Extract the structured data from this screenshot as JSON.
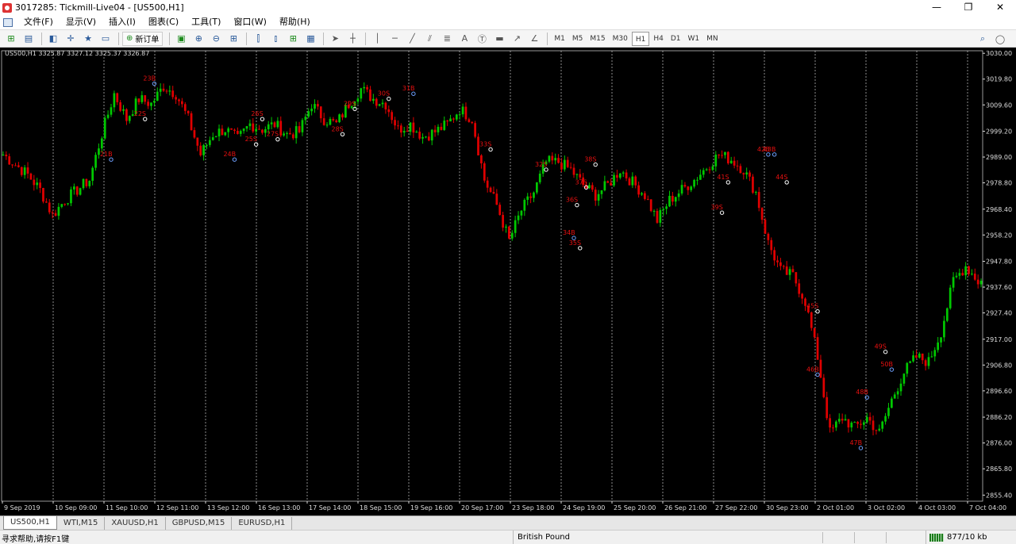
{
  "window": {
    "title": "3017285: Tickmill-Live04 - [US500,H1]",
    "controls": [
      "—",
      "❐",
      "✕"
    ]
  },
  "menu": {
    "items": [
      "文件(F)",
      "显示(V)",
      "插入(I)",
      "图表(C)",
      "工具(T)",
      "窗口(W)",
      "帮助(H)"
    ]
  },
  "toolbar": {
    "new_order_label": "新订单",
    "timeframes": [
      "M1",
      "M5",
      "M15",
      "M30",
      "H1",
      "H4",
      "D1",
      "W1",
      "MN"
    ],
    "active_timeframe": "H1"
  },
  "chart": {
    "info": "US500,H1  3325.87 3327.12 3325.37 3326.87",
    "colors": {
      "background": "#000000",
      "up": "#00c800",
      "down": "#e00000",
      "grid": "#c8c8c8",
      "marker_text": "#e81010"
    }
  },
  "chart_data": {
    "type": "candlestick",
    "symbol": "US500",
    "timeframe": "H1",
    "y_ticks": [
      3030.0,
      3019.8,
      3009.6,
      2999.2,
      2989.0,
      2978.8,
      2968.4,
      2958.2,
      2947.8,
      2937.6,
      2927.4,
      2917.0,
      2906.8,
      2896.6,
      2886.2,
      2876.0,
      2865.8,
      2855.4
    ],
    "ylim": [
      2853.0,
      3031.0
    ],
    "x_ticks": [
      "9 Sep 2019",
      "10 Sep 09:00",
      "11 Sep 10:00",
      "12 Sep 11:00",
      "13 Sep 12:00",
      "16 Sep 13:00",
      "17 Sep 14:00",
      "18 Sep 15:00",
      "19 Sep 16:00",
      "20 Sep 17:00",
      "23 Sep 18:00",
      "24 Sep 19:00",
      "25 Sep 20:00",
      "26 Sep 21:00",
      "27 Sep 22:00",
      "30 Sep 23:00",
      "2 Oct 01:00",
      "3 Oct 02:00",
      "4 Oct 03:00",
      "7 Oct 04:00"
    ],
    "price_path": [
      [
        0,
        2990
      ],
      [
        4,
        2986
      ],
      [
        8,
        2982
      ],
      [
        12,
        2976
      ],
      [
        16,
        2966
      ],
      [
        20,
        2972
      ],
      [
        24,
        2976
      ],
      [
        28,
        2980
      ],
      [
        32,
        2998
      ],
      [
        36,
        3014
      ],
      [
        40,
        3004
      ],
      [
        44,
        3012
      ],
      [
        48,
        3010
      ],
      [
        52,
        3017
      ],
      [
        56,
        3014
      ],
      [
        60,
        3004
      ],
      [
        64,
        2990
      ],
      [
        68,
        2998
      ],
      [
        72,
        3000
      ],
      [
        76,
        2996
      ],
      [
        80,
        3002
      ],
      [
        84,
        3000
      ],
      [
        88,
        3002
      ],
      [
        92,
        2998
      ],
      [
        96,
        2999
      ],
      [
        100,
        3010
      ],
      [
        104,
        3004
      ],
      [
        108,
        3002
      ],
      [
        112,
        3010
      ],
      [
        116,
        3016
      ],
      [
        120,
        3012
      ],
      [
        124,
        3010
      ],
      [
        128,
        3000
      ],
      [
        132,
        3002
      ],
      [
        136,
        2997
      ],
      [
        140,
        2999
      ],
      [
        144,
        3002
      ],
      [
        148,
        3008
      ],
      [
        152,
        3004
      ],
      [
        156,
        2980
      ],
      [
        160,
        2970
      ],
      [
        164,
        2956
      ],
      [
        168,
        2968
      ],
      [
        172,
        2975
      ],
      [
        176,
        2987
      ],
      [
        180,
        2987
      ],
      [
        184,
        2984
      ],
      [
        188,
        2978
      ],
      [
        192,
        2974
      ],
      [
        196,
        2978
      ],
      [
        200,
        2984
      ],
      [
        204,
        2979
      ],
      [
        208,
        2974
      ],
      [
        212,
        2964
      ],
      [
        216,
        2972
      ],
      [
        220,
        2976
      ],
      [
        224,
        2980
      ],
      [
        228,
        2985
      ],
      [
        232,
        2990
      ],
      [
        236,
        2988
      ],
      [
        240,
        2984
      ],
      [
        244,
        2975
      ],
      [
        248,
        2955
      ],
      [
        252,
        2944
      ],
      [
        256,
        2942
      ],
      [
        260,
        2932
      ],
      [
        264,
        2910
      ],
      [
        268,
        2880
      ],
      [
        272,
        2886
      ],
      [
        276,
        2882
      ],
      [
        280,
        2886
      ],
      [
        284,
        2880
      ],
      [
        288,
        2893
      ],
      [
        292,
        2904
      ],
      [
        296,
        2910
      ],
      [
        300,
        2908
      ],
      [
        304,
        2920
      ],
      [
        308,
        2940
      ],
      [
        312,
        2946
      ],
      [
        316,
        2940
      ]
    ],
    "markers": [
      {
        "label": "21B",
        "x": 35,
        "y": 2988
      },
      {
        "label": "22S",
        "x": 46,
        "y": 3004
      },
      {
        "label": "23B",
        "x": 49,
        "y": 3018
      },
      {
        "label": "24B",
        "x": 75,
        "y": 2988
      },
      {
        "label": "25S",
        "x": 82,
        "y": 2994
      },
      {
        "label": "26S",
        "x": 84,
        "y": 3004
      },
      {
        "label": "27S",
        "x": 89,
        "y": 2996
      },
      {
        "label": "28S",
        "x": 110,
        "y": 2998
      },
      {
        "label": "29S",
        "x": 114,
        "y": 3008
      },
      {
        "label": "30S",
        "x": 125,
        "y": 3012
      },
      {
        "label": "31B",
        "x": 133,
        "y": 3014
      },
      {
        "label": "32S",
        "x": 176,
        "y": 2984
      },
      {
        "label": "33S",
        "x": 158,
        "y": 2992
      },
      {
        "label": "34B",
        "x": 185,
        "y": 2957
      },
      {
        "label": "35S",
        "x": 187,
        "y": 2953
      },
      {
        "label": "36S",
        "x": 186,
        "y": 2970
      },
      {
        "label": "37S",
        "x": 189,
        "y": 2977
      },
      {
        "label": "38S",
        "x": 192,
        "y": 2986
      },
      {
        "label": "39S",
        "x": 233,
        "y": 2967
      },
      {
        "label": "41S",
        "x": 235,
        "y": 2979
      },
      {
        "label": "42B",
        "x": 248,
        "y": 2990
      },
      {
        "label": "43B",
        "x": 250,
        "y": 2990
      },
      {
        "label": "44S",
        "x": 254,
        "y": 2979
      },
      {
        "label": "45S",
        "x": 264,
        "y": 2928
      },
      {
        "label": "46B",
        "x": 264,
        "y": 2903
      },
      {
        "label": "47B",
        "x": 278,
        "y": 2874
      },
      {
        "label": "48B",
        "x": 280,
        "y": 2894
      },
      {
        "label": "49S",
        "x": 286,
        "y": 2912
      },
      {
        "label": "50B",
        "x": 288,
        "y": 2905
      }
    ]
  },
  "chart_tabs": {
    "items": [
      "US500,H1",
      "WTI,M15",
      "XAUUSD,H1",
      "GBPUSD,M15",
      "EURUSD,H1"
    ],
    "active": "US500,H1"
  },
  "status": {
    "hint": "寻求帮助,请按F1键",
    "profile": "British Pound",
    "traffic": "877/10 kb"
  }
}
